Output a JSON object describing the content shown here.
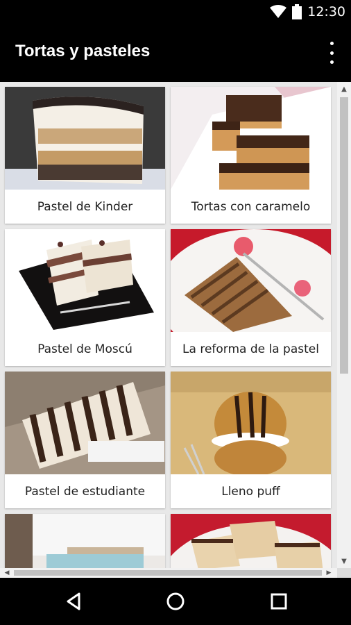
{
  "status": {
    "time": "12:30"
  },
  "app": {
    "title": "Tortas y pasteles"
  },
  "cards": [
    {
      "label": "Pastel de Kinder"
    },
    {
      "label": "Tortas con caramelo"
    },
    {
      "label": "Pastel de Moscú"
    },
    {
      "label": "La reforma de la pastel"
    },
    {
      "label": "Pastel de estudiante"
    },
    {
      "label": "Lleno puff"
    },
    {
      "label": ""
    },
    {
      "label": ""
    }
  ],
  "icons": {
    "wifi": "wifi-icon",
    "battery": "battery-icon",
    "menu": "more-vert-icon",
    "back": "back-icon",
    "home": "home-icon",
    "recents": "recents-icon"
  }
}
